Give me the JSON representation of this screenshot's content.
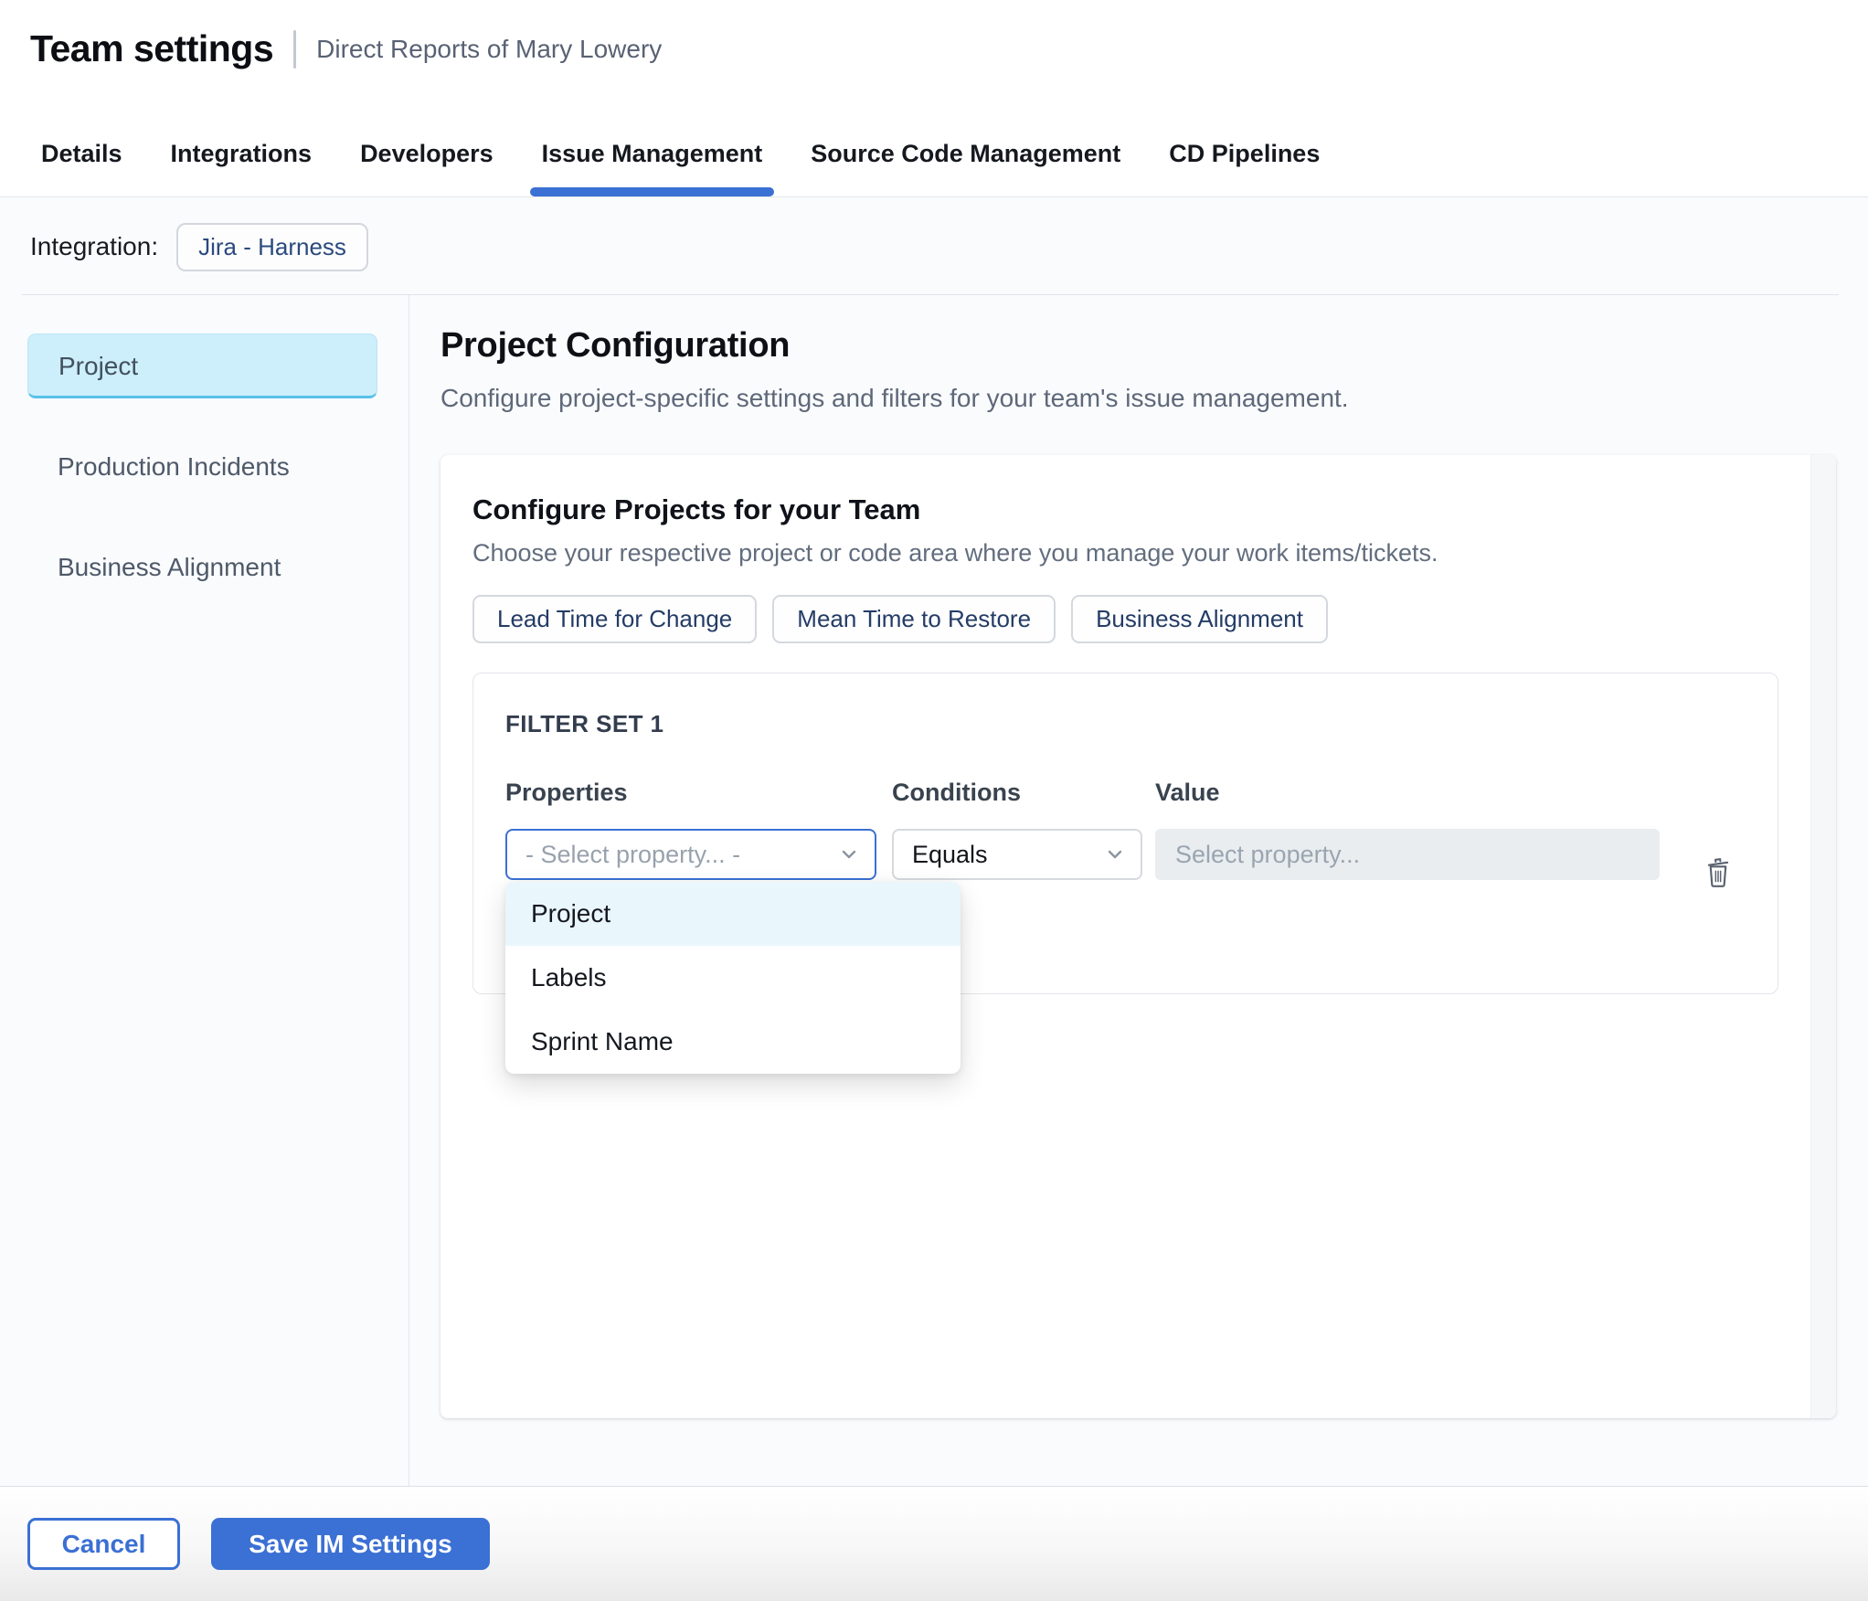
{
  "header": {
    "title": "Team settings",
    "subtitle": "Direct Reports of Mary Lowery"
  },
  "tabs": [
    {
      "label": "Details",
      "active": false
    },
    {
      "label": "Integrations",
      "active": false
    },
    {
      "label": "Developers",
      "active": false
    },
    {
      "label": "Issue Management",
      "active": true
    },
    {
      "label": "Source Code Management",
      "active": false
    },
    {
      "label": "CD Pipelines",
      "active": false
    }
  ],
  "integration": {
    "label": "Integration:",
    "value": "Jira - Harness"
  },
  "sidebar": {
    "items": [
      {
        "label": "Project",
        "selected": true
      },
      {
        "label": "Production Incidents",
        "selected": false
      },
      {
        "label": "Business Alignment",
        "selected": false
      }
    ]
  },
  "main": {
    "title": "Project Configuration",
    "subtitle": "Configure project-specific settings and filters for your team's issue management.",
    "card": {
      "title": "Configure Projects for your Team",
      "subtitle": "Choose your respective project or code area where you manage your work items/tickets.",
      "chips": [
        "Lead Time for Change",
        "Mean Time to Restore",
        "Business Alignment"
      ],
      "filter_set": {
        "title": "FILTER SET 1",
        "columns": {
          "properties": "Properties",
          "conditions": "Conditions",
          "value": "Value"
        },
        "properties_placeholder": "- Select property... -",
        "conditions_value": "Equals",
        "value_placeholder": "Select property...",
        "dropdown_options": [
          {
            "label": "Project",
            "highlighted": true
          },
          {
            "label": "Labels",
            "highlighted": false
          },
          {
            "label": "Sprint Name",
            "highlighted": false
          }
        ]
      }
    }
  },
  "footer": {
    "cancel_label": "Cancel",
    "save_label": "Save IM Settings"
  },
  "icons": {
    "properties_select": "chevron-down",
    "conditions_select": "chevron-down",
    "delete_filter": "trash"
  },
  "colors": {
    "accent": "#3b70d4",
    "sidebar_selected_bg": "#cdeefb",
    "sidebar_selected_border": "#58c2e9",
    "dropdown_highlight_bg": "#e9f6fc",
    "value_input_bg": "#e9edf0"
  }
}
